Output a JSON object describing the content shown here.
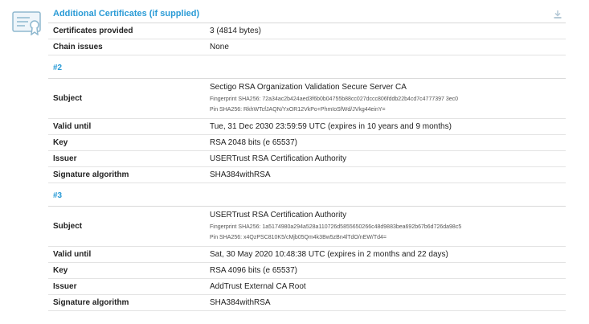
{
  "section": {
    "title": "Additional Certificates (if supplied)",
    "icons": {
      "certificate": "certificate-icon",
      "download": "download-icon"
    },
    "summary": [
      {
        "label": "Certificates provided",
        "value": "3 (4814 bytes)"
      },
      {
        "label": "Chain issues",
        "value": "None"
      }
    ]
  },
  "certs": [
    {
      "heading": "#2",
      "subject": "Sectigo RSA Organization Validation Secure Server CA",
      "fingerprint": "Fingerprint SHA256: 72a34ac2b424aed3f6b0b04755b88cc027dccc806fddb22b4cd7c4777397 3ec0",
      "pin": "Pin SHA256: RkhWTcfJAQN/YxOR12VkPo+PhmIoSfWd/JVkg44einY=",
      "valid_until": "Tue, 31 Dec 2030 23:59:59 UTC (expires in 10 years and 9 months)",
      "key": "RSA 2048 bits (e 65537)",
      "issuer": "USERTrust RSA Certification Authority",
      "sig_alg": "SHA384withRSA"
    },
    {
      "heading": "#3",
      "subject": "USERTrust RSA Certification Authority",
      "fingerprint": "Fingerprint SHA256: 1a5174980a294a528a110726d5855650266c48d9883bea692b67b6d726da98c5",
      "pin": "Pin SHA256: x4QzPSC810K5/cMjb05Qm4k3Bw5zBn4lTdO/nEW/Td4=",
      "valid_until": "Sat, 30 May 2020 10:48:38 UTC (expires in 2 months and 22 days)",
      "key": "RSA 4096 bits (e 65537)",
      "issuer": "AddTrust External CA Root",
      "sig_alg": "SHA384withRSA"
    }
  ],
  "labels": {
    "subject": "Subject",
    "valid_until": "Valid until",
    "key": "Key",
    "issuer": "Issuer",
    "sig_alg": "Signature algorithm"
  }
}
